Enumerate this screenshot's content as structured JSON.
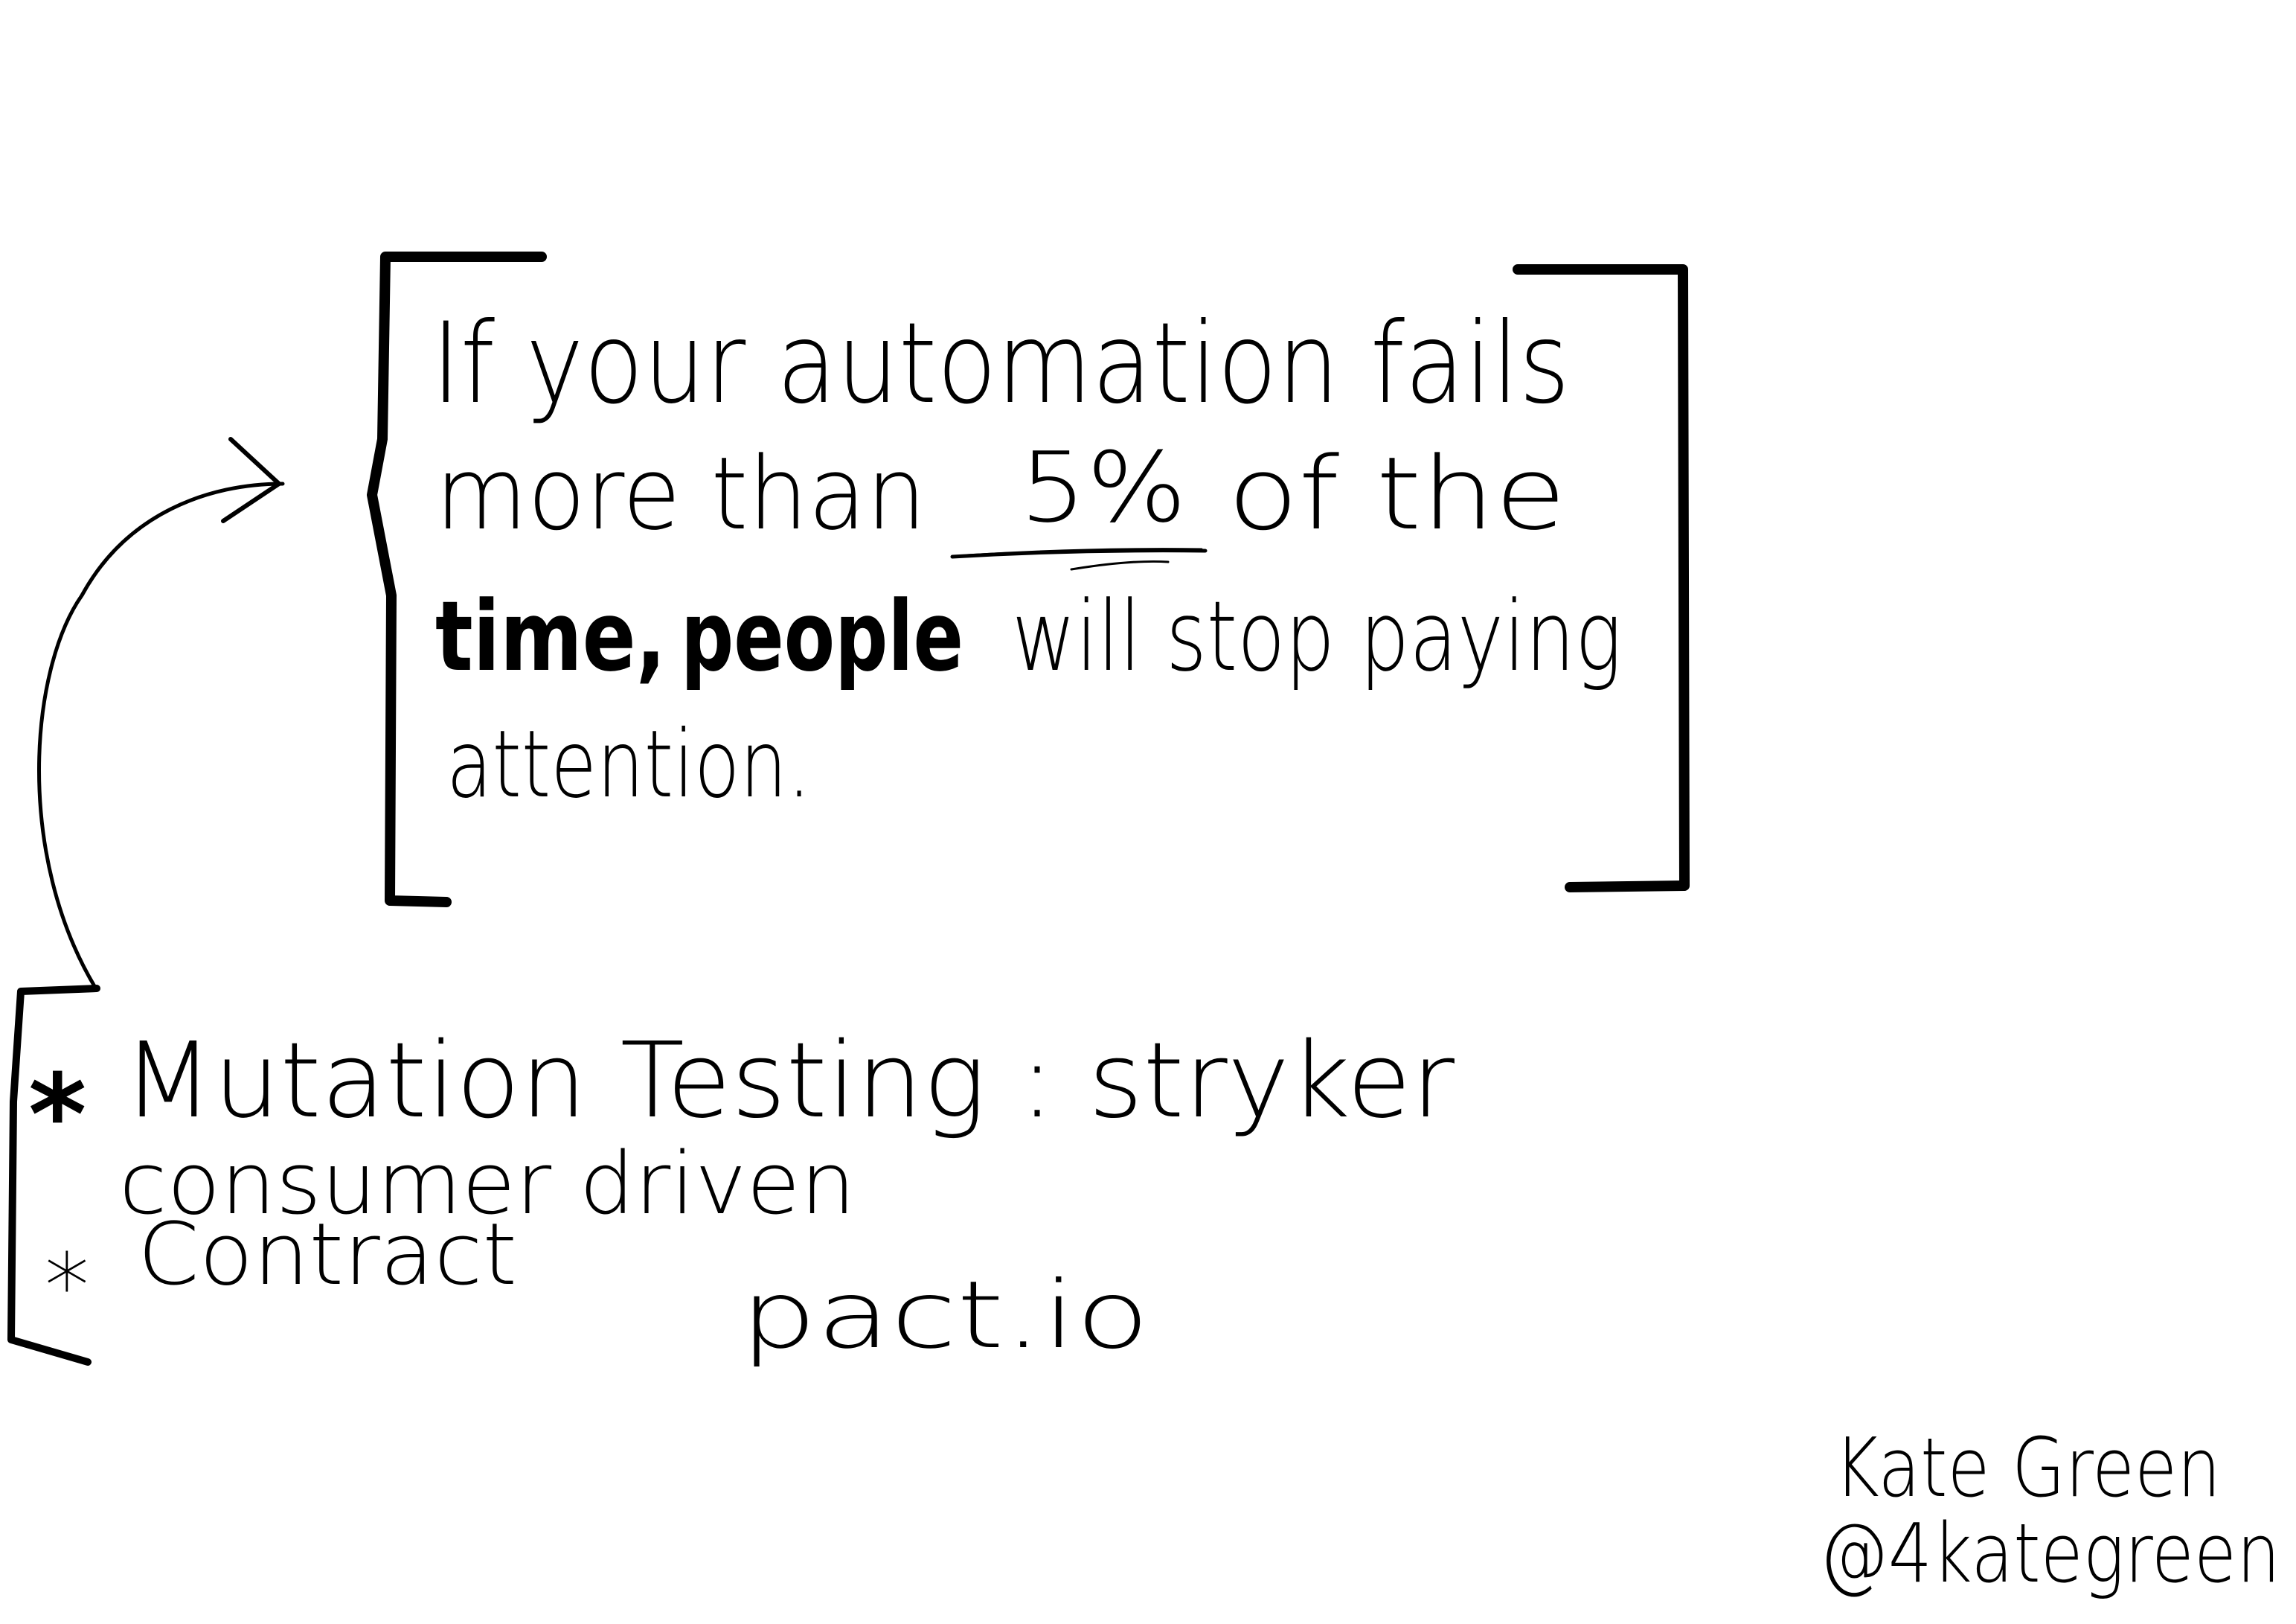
{
  "quote": {
    "line1": "If your automation fails",
    "line2_a": "more than",
    "line2_b": "5%",
    "line2_c": "of the",
    "line3_a": "time,",
    "line3_b": "people",
    "line3_c": "will stop paying",
    "line4": "attention."
  },
  "notes": {
    "item1_bullet": "*",
    "item1": "Mutation Testing : stryker",
    "item2_line1": "consumer driven",
    "item2_bullet": "*",
    "item2_line2": "Contract",
    "item2_tool": "pact.io"
  },
  "signature": {
    "name": "Kate Green",
    "handle": "@4kategreen"
  },
  "colors": {
    "ink": "#000000",
    "paper": "#ffffff"
  }
}
